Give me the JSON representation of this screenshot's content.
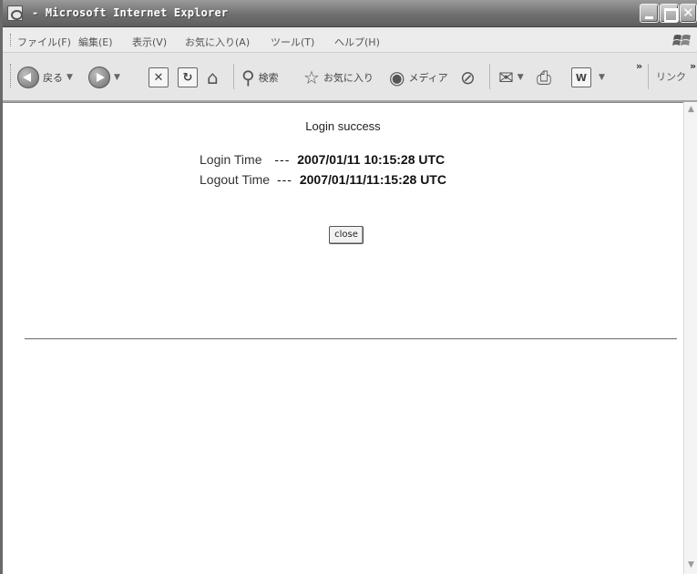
{
  "window": {
    "title": "- Microsoft Internet Explorer"
  },
  "menubar": {
    "items": [
      {
        "label": "ファイル(F)"
      },
      {
        "label": "編集(E)"
      },
      {
        "label": "表示(V)"
      },
      {
        "label": "お気に入り(A)"
      },
      {
        "label": "ツール(T)"
      },
      {
        "label": "ヘルプ(H)"
      }
    ]
  },
  "toolbar": {
    "back_label": "戻る",
    "search_label": "検索",
    "favorites_label": "お気に入り",
    "media_label": "メディア",
    "links_label": "リンク",
    "chevron": "»",
    "icons": [
      "back-icon",
      "forward-icon",
      "stop-icon",
      "refresh-icon",
      "home-icon",
      "search-icon",
      "favorites-star-icon",
      "media-icon",
      "history-icon",
      "mail-icon",
      "print-icon",
      "word-icon"
    ]
  },
  "page": {
    "status_message": "Login success",
    "login_label": "Login Time",
    "login_dashes": "---",
    "login_value": "2007/01/11 10:15:28 UTC",
    "logout_label": "Logout Time",
    "logout_dashes": "---",
    "logout_value": "2007/01/11/11:15:28 UTC",
    "close_button": "close"
  },
  "colors": {
    "titlebar": "#707070",
    "toolbar_bg": "#e6e6e6",
    "content_bg": "#ffffff"
  }
}
